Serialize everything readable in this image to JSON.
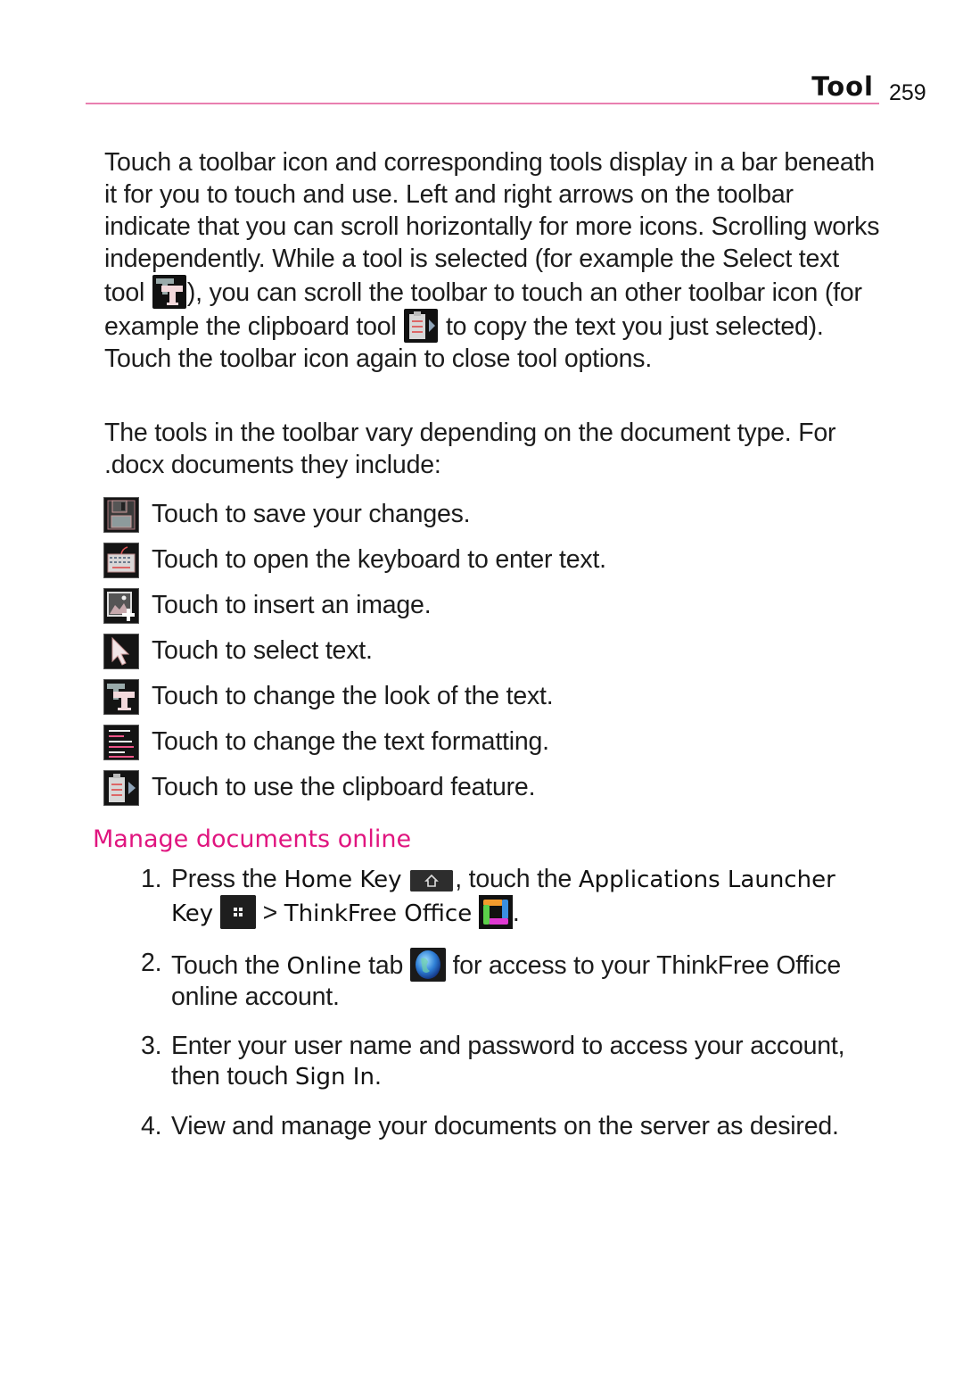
{
  "header": {
    "section_title": "Tool",
    "page_number": "259",
    "accent_color": "#e97fb0"
  },
  "intro": {
    "p1_a": "Touch a toolbar icon and corresponding tools display in a bar beneath it for you to touch and use. Left and right arrows on the toolbar indicate that you can scroll horizontally for more icons. Scrolling works independently. While a tool is selected (for example the Select text tool ",
    "p1_b": "), you can scroll the toolbar to touch an other toolbar icon (for example the clipboard tool ",
    "p1_c": " to copy the text you just selected). Touch the toolbar icon again to close tool options.",
    "p2": "The tools in the toolbar vary depending on the document type. For .docx documents they include:"
  },
  "tools": [
    {
      "icon": "save-icon",
      "label": "Touch to save your changes."
    },
    {
      "icon": "keyboard-icon",
      "label": "Touch to open the keyboard to enter text."
    },
    {
      "icon": "insert-image-icon",
      "label": "Touch to insert an image."
    },
    {
      "icon": "select-pointer-icon",
      "label": "Touch to select text."
    },
    {
      "icon": "text-style-icon",
      "label": "Touch to change the look of the text."
    },
    {
      "icon": "text-format-icon",
      "label": "Touch to change the text formatting."
    },
    {
      "icon": "clipboard-icon",
      "label": "Touch to use the clipboard feature."
    }
  ],
  "manage": {
    "heading": "Manage documents online",
    "heading_color": "#e0157f",
    "steps": [
      {
        "num": "1.",
        "t1": "Press the ",
        "k1": "Home Key",
        "t2": ", touch the ",
        "k2": "Applications Launcher Key",
        "t3": " > ",
        "k3": "ThinkFree Office",
        "t4": "."
      },
      {
        "num": "2.",
        "t1": "Touch the ",
        "k1": "Online",
        "t2": " tab ",
        "t3": " for access to your ThinkFree Office online account."
      },
      {
        "num": "3.",
        "t1": "Enter your user name and password to access your account, then touch ",
        "k1": "Sign In",
        "t2": "."
      },
      {
        "num": "4.",
        "t1": "View and manage your documents on the server as desired."
      }
    ]
  }
}
